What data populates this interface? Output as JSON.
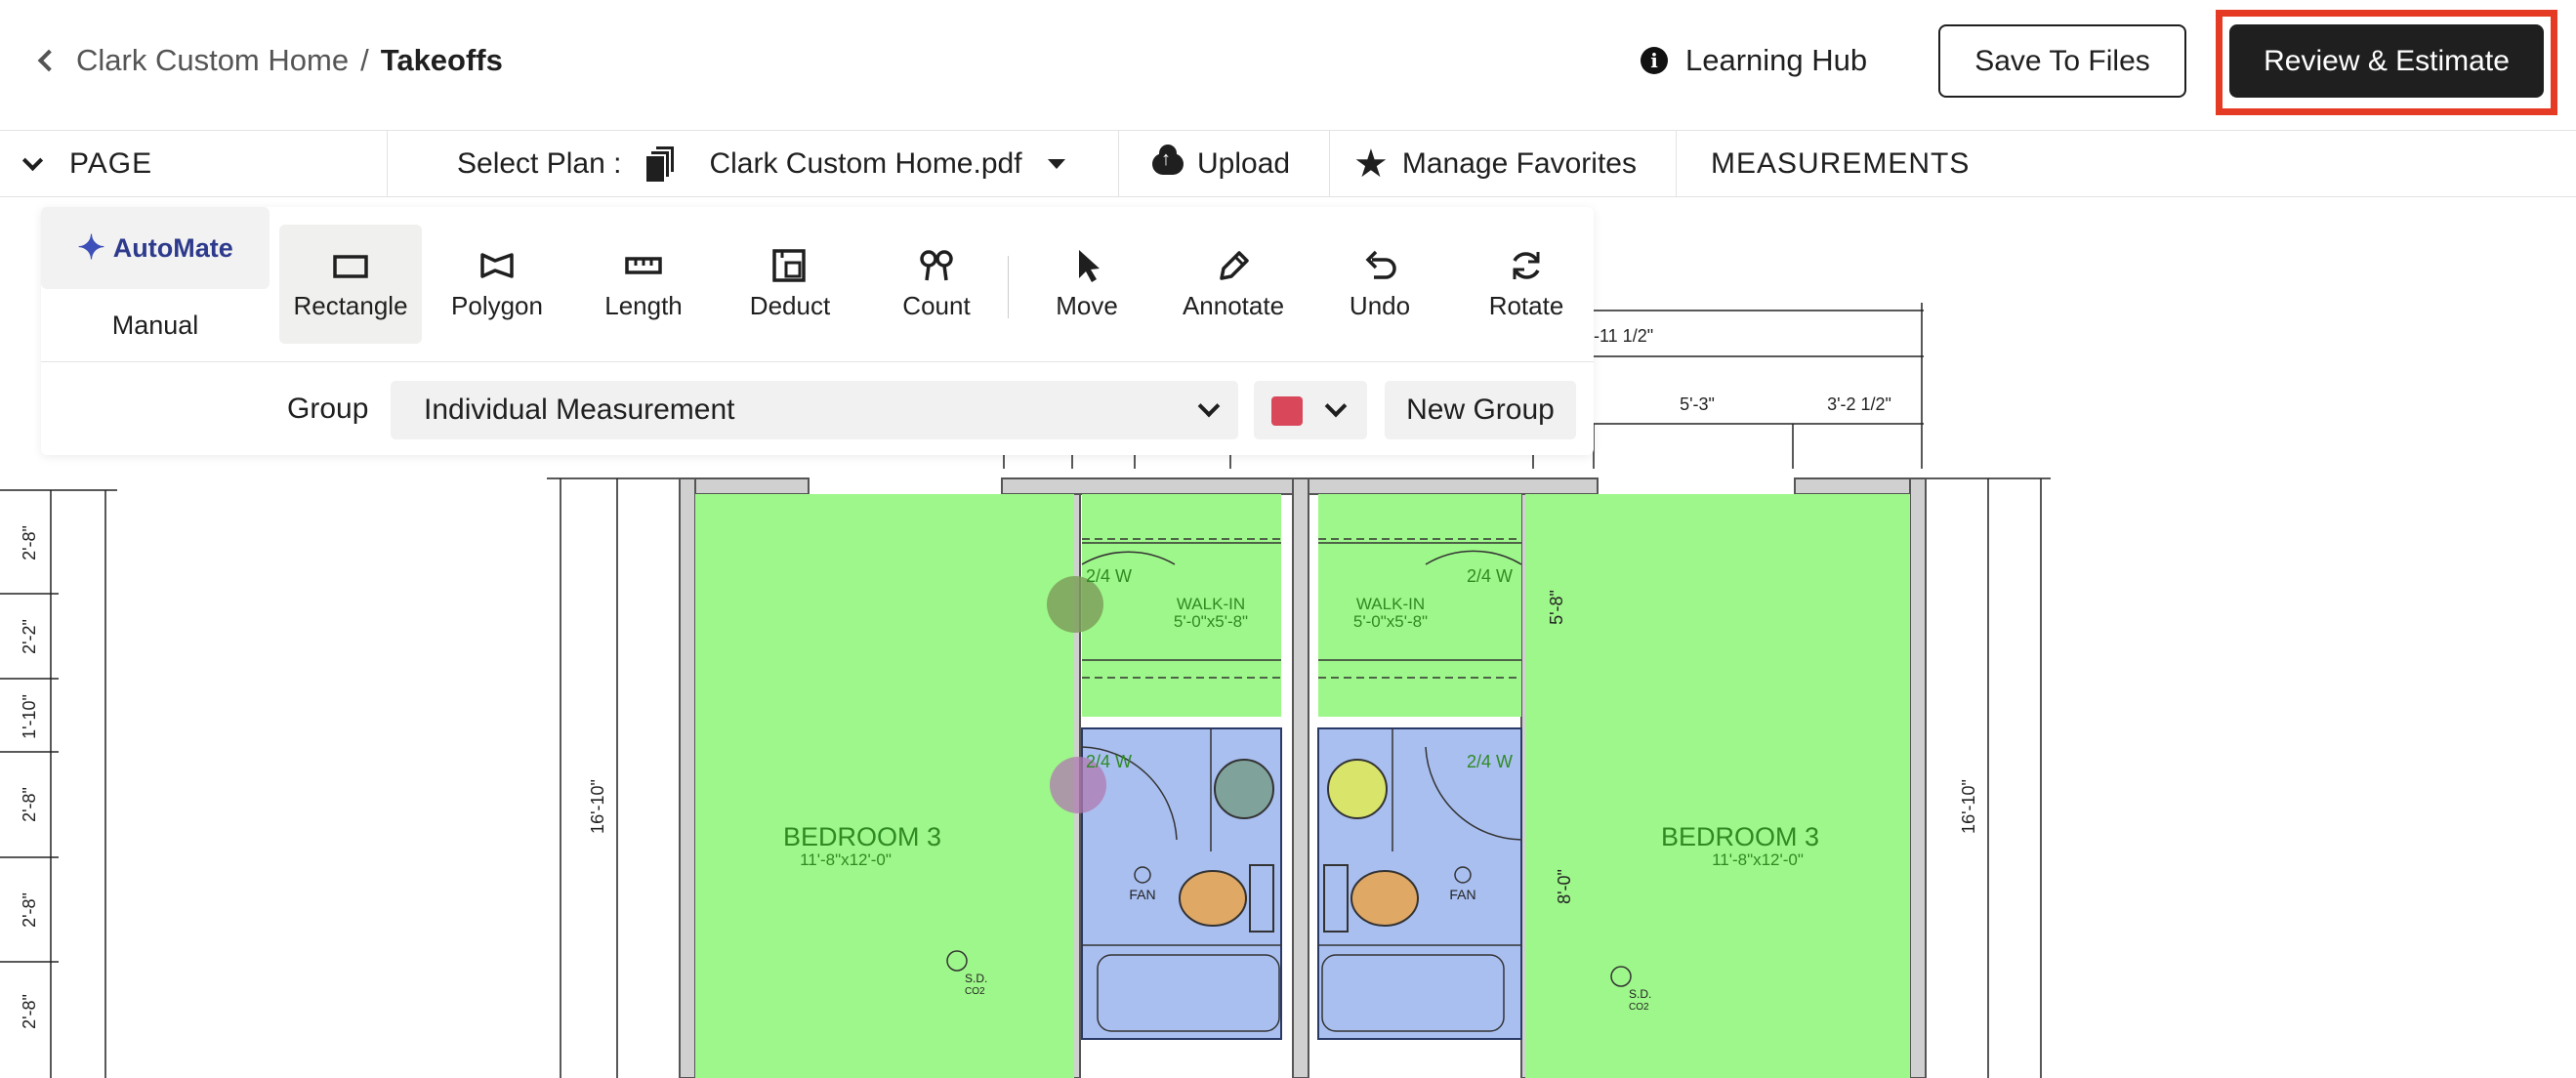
{
  "header": {
    "breadcrumb_parent": "Clark Custom Home",
    "breadcrumb_separator": "/",
    "breadcrumb_current": "Takeoffs",
    "learning_hub": "Learning Hub",
    "save_button": "Save To Files",
    "review_button": "Review & Estimate",
    "highlight_color": "#e53b24"
  },
  "subbar": {
    "page_label": "PAGE",
    "select_plan_label": "Select Plan :",
    "plan_name": "Clark Custom Home.pdf",
    "upload": "Upload",
    "manage_favorites": "Manage Favorites",
    "measurements": "MEASUREMENTS"
  },
  "toolbar": {
    "mode_automate": "AutoMate",
    "mode_manual": "Manual",
    "tools": [
      "Rectangle",
      "Polygon",
      "Length",
      "Deduct",
      "Count",
      "Move",
      "Annotate",
      "Undo",
      "Rotate"
    ],
    "active_tool": "Rectangle",
    "group_label": "Group",
    "group_value": "Individual Measurement",
    "group_color": "#d9475b",
    "new_group": "New Group"
  },
  "plan": {
    "room_left_name": "BEDROOM 3",
    "room_left_size": "11'-8\"x12'-0\"",
    "room_right_name": "BEDROOM 3",
    "room_right_size": "11'-8\"x12'-0\"",
    "closet_left_name": "WALK-IN",
    "closet_left_size": "5'-0\"x5'-8\"",
    "closet_right_name": "WALK-IN",
    "closet_right_size": "5'-0\"x5'-8\"",
    "door_24w": "2/4 W",
    "fan": "FAN",
    "sd": "S.D.",
    "co2": "CO2",
    "dim_top_a": "-11 1/2\"",
    "dim_top_b": "5'-3\"",
    "dim_top_c": "3'-2 1/2\"",
    "dim_left_room": "16'-10\"",
    "dim_right_room": "16'-10\"",
    "dim_closet": "5'-8\"",
    "dim_bath": "8'-0\"",
    "dim_side": [
      "2'-8\"",
      "2'-2\"",
      "1'-10\"",
      "2'-8\"",
      "2'-8\"",
      "2'-8\""
    ],
    "room_fill": "#9ef78a",
    "bath_fill": "#a9bff0"
  }
}
